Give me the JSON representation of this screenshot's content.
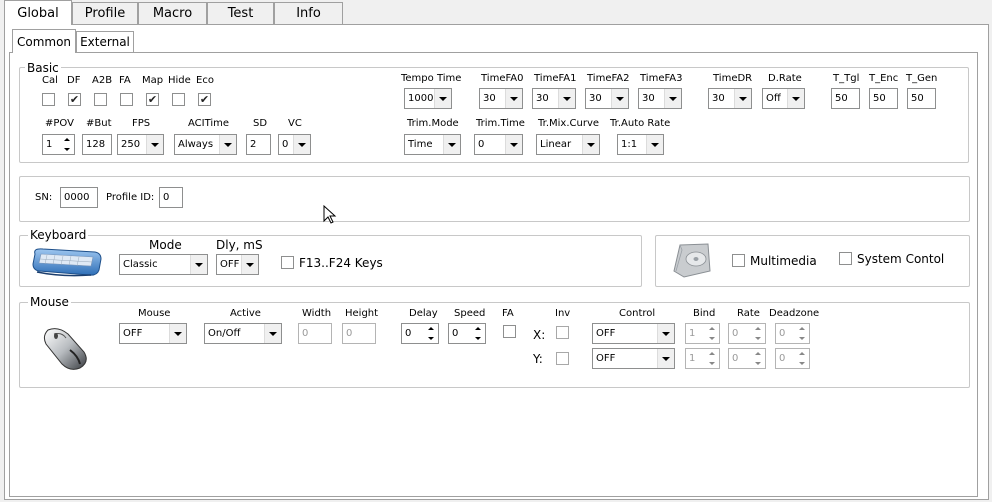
{
  "tabs": [
    "Global",
    "Profile",
    "Macro",
    "Test",
    "Info"
  ],
  "subtabs": [
    "Common",
    "External"
  ],
  "basic": {
    "title": "Basic",
    "checks": [
      {
        "label": "Cal",
        "checked": false
      },
      {
        "label": "DF",
        "checked": true
      },
      {
        "label": "A2B",
        "checked": false
      },
      {
        "label": "FA",
        "checked": false
      },
      {
        "label": "Map",
        "checked": true
      },
      {
        "label": "Hide",
        "checked": false
      },
      {
        "label": "Eco",
        "checked": true
      }
    ],
    "tempo_time": {
      "label": "Tempo Time",
      "value": "1000"
    },
    "timefa0": {
      "label": "TimeFA0",
      "value": "30"
    },
    "timefa1": {
      "label": "TimeFA1",
      "value": "30"
    },
    "timefa2": {
      "label": "TimeFA2",
      "value": "30"
    },
    "timefa3": {
      "label": "TimeFA3",
      "value": "30"
    },
    "timedr": {
      "label": "TimeDR",
      "value": "30"
    },
    "drate": {
      "label": "D.Rate",
      "value": "Off"
    },
    "t_tgl": {
      "label": "T_Tgl",
      "value": "50"
    },
    "t_enc": {
      "label": "T_Enc",
      "value": "50"
    },
    "t_gen": {
      "label": "T_Gen",
      "value": "50"
    },
    "pov": {
      "label": "#POV",
      "value": "1"
    },
    "but": {
      "label": "#But",
      "value": "128"
    },
    "fps": {
      "label": "FPS",
      "value": "250"
    },
    "acitime": {
      "label": "ACITime",
      "value": "Always"
    },
    "sd": {
      "label": "SD",
      "value": "2"
    },
    "vc": {
      "label": "VC",
      "value": "0"
    },
    "trim_mode": {
      "label": "Trim.Mode",
      "value": "Time"
    },
    "trim_time": {
      "label": "Trim.Time",
      "value": "0"
    },
    "tr_mix_curve": {
      "label": "Tr.Mix.Curve",
      "value": "Linear"
    },
    "tr_auto_rate": {
      "label": "Tr.Auto Rate",
      "value": "1:1"
    }
  },
  "sn": {
    "label": "SN:",
    "value": "0000",
    "profile_label": "Profile ID:",
    "profile_value": "0"
  },
  "keyboard": {
    "title": "Keyboard",
    "mode_label": "Mode",
    "mode_value": "Classic",
    "dly_label": "Dly, mS",
    "dly_value": "OFF",
    "f13_label": "F13..F24 Keys"
  },
  "media": {
    "multimedia": "Multimedia",
    "system": "System Contol"
  },
  "mouse": {
    "title": "Mouse",
    "mouse_label": "Mouse",
    "mouse_value": "OFF",
    "active_label": "Active",
    "active_value": "On/Off",
    "width_label": "Width",
    "width_value": "0",
    "height_label": "Height",
    "height_value": "0",
    "delay_label": "Delay",
    "delay_value": "0",
    "speed_label": "Speed",
    "speed_value": "0",
    "fa_label": "FA",
    "inv_label": "Inv",
    "x_label": "X:",
    "y_label": "Y:",
    "control_label": "Control",
    "bind_label": "Bind",
    "rate_label": "Rate",
    "deadzone_label": "Deadzone",
    "rows": [
      {
        "control": "OFF",
        "bind": "1",
        "rate": "0",
        "deadzone": "0"
      },
      {
        "control": "OFF",
        "bind": "1",
        "rate": "0",
        "deadzone": "0"
      }
    ]
  }
}
